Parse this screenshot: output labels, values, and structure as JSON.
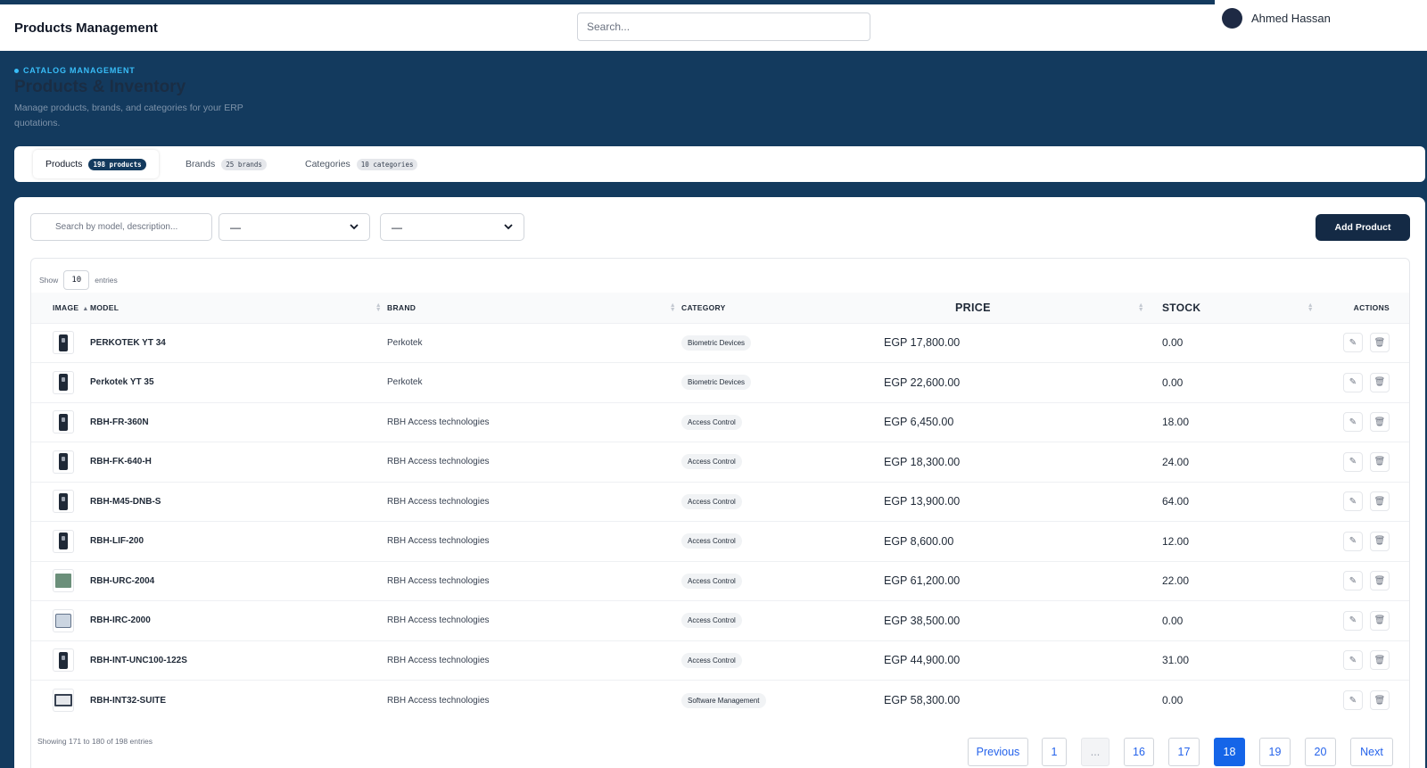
{
  "header": {
    "app_title": "Products Management",
    "search_placeholder": "Search...",
    "user_name": "Ahmed Hassan"
  },
  "hero": {
    "eyebrow": "CATALOG MANAGEMENT",
    "title": "Products & Inventory",
    "subtitle": "Manage products, brands, and categories for your ERP quotations."
  },
  "tabs": [
    {
      "label": "Products",
      "badge": "198 products",
      "active": true
    },
    {
      "label": "Brands",
      "badge": "25 brands",
      "active": false
    },
    {
      "label": "Categories",
      "badge": "10 categories",
      "active": false
    }
  ],
  "filters": {
    "search_placeholder": "Search by model, description...",
    "brand_select": "—",
    "category_select": "—",
    "add_button": "Add Product"
  },
  "table": {
    "show_label": "Show",
    "show_value": "10",
    "entries_label": "entries",
    "columns": [
      "IMAGE",
      "MODEL",
      "BRAND",
      "CATEGORY",
      "PRICE",
      "STOCK",
      "ACTIONS"
    ],
    "rows": [
      {
        "model": "PERKOTEK YT 34",
        "brand": "Perkotek",
        "category": "Biometric Devices",
        "price": "EGP  17,800.00",
        "stock": "0.00",
        "image": "device-image"
      },
      {
        "model": "Perkotek YT 35",
        "brand": "Perkotek",
        "category": "Biometric Devices",
        "price": "EGP  22,600.00",
        "stock": "0.00",
        "image": "device-image"
      },
      {
        "model": "RBH-FR-360N",
        "brand": "RBH Access technologies",
        "category": "Access Control",
        "price": "EGP  6,450.00",
        "stock": "18.00",
        "image": "device-image"
      },
      {
        "model": "RBH-FK-640-H",
        "brand": "RBH Access technologies",
        "category": "Access Control",
        "price": "EGP  18,300.00",
        "stock": "24.00",
        "image": "device-image"
      },
      {
        "model": "RBH-M45-DNB-S",
        "brand": "RBH Access technologies",
        "category": "Access Control",
        "price": "EGP  13,900.00",
        "stock": "64.00",
        "image": "device-image"
      },
      {
        "model": "RBH-LIF-200",
        "brand": "RBH Access technologies",
        "category": "Access Control",
        "price": "EGP  8,600.00",
        "stock": "12.00",
        "image": "device-image"
      },
      {
        "model": "RBH-URC-2004",
        "brand": "RBH Access technologies",
        "category": "Access Control",
        "price": "EGP  61,200.00",
        "stock": "22.00",
        "image": "board-image"
      },
      {
        "model": "RBH-IRC-2000",
        "brand": "RBH Access technologies",
        "category": "Access Control",
        "price": "EGP  38,500.00",
        "stock": "0.00",
        "image": "board-image"
      },
      {
        "model": "RBH-INT-UNC100-122S",
        "brand": "RBH Access technologies",
        "category": "Access Control",
        "price": "EGP  44,900.00",
        "stock": "31.00",
        "image": "device-image"
      },
      {
        "model": "RBH-INT32-SUITE",
        "brand": "RBH Access technologies",
        "category": "Software Management",
        "price": "EGP  58,300.00",
        "stock": "0.00",
        "image": "monitor-image"
      }
    ],
    "footer_info": "Showing 171 to 180 of 198 entries"
  },
  "pagination": {
    "previous": "Previous",
    "pages": [
      "1",
      "...",
      "16",
      "17",
      "18",
      "19",
      "20"
    ],
    "current": "18",
    "next": "Next"
  },
  "colors": {
    "header_band": "#133a5e",
    "accent": "#1565e8",
    "primary_button": "#142a45"
  },
  "icons": {
    "sort": "sort-icon",
    "chevron": "chevron-down-icon",
    "edit": "pencil-icon",
    "delete": "trash-icon"
  }
}
